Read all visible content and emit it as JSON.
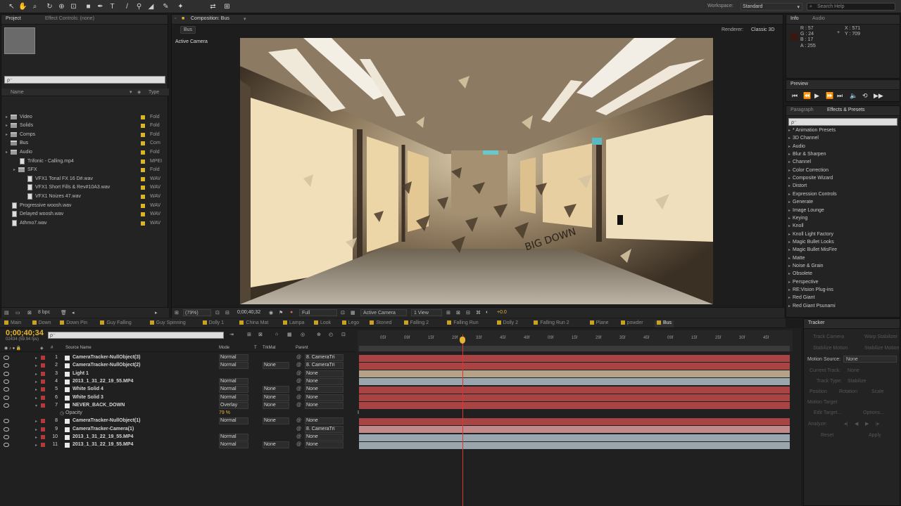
{
  "toolbar": {
    "workspace_label": "Workspace:",
    "workspace_value": "Standard",
    "search_placeholder": "Search Help"
  },
  "project": {
    "tabs": [
      "Project",
      "Effect Controls: (none)"
    ],
    "search_placeholder": "ρ⁻",
    "col_name": "Name",
    "col_type": "Type",
    "items": [
      {
        "name": "Video",
        "type": "Fold",
        "kind": "folder",
        "indent": 0
      },
      {
        "name": "Solids",
        "type": "Fold",
        "kind": "folder",
        "indent": 0
      },
      {
        "name": "Comps",
        "type": "Fold",
        "kind": "folder",
        "indent": 0
      },
      {
        "name": "Bus",
        "type": "Com",
        "kind": "comp",
        "indent": 0
      },
      {
        "name": "Audio",
        "type": "Fold",
        "kind": "folder",
        "indent": 0
      },
      {
        "name": "Trifonic - Calling.mp4",
        "type": "MPEI",
        "kind": "file",
        "indent": 1
      },
      {
        "name": "SFX",
        "type": "Fold",
        "kind": "folder",
        "indent": 1
      },
      {
        "name": "VFX1 Tonal FX 16 D#.wav",
        "type": "WAV",
        "kind": "file",
        "indent": 2
      },
      {
        "name": "VFX1 Short Fills & Rev#10A3.wav",
        "type": "WAV",
        "kind": "file",
        "indent": 2
      },
      {
        "name": "VFX1 Noizes 47.wav",
        "type": "WAV",
        "kind": "file",
        "indent": 2
      },
      {
        "name": "Progressive woosh.wav",
        "type": "WAV",
        "kind": "file",
        "indent": 0
      },
      {
        "name": "Delayed woosh.wav",
        "type": "WAV",
        "kind": "file",
        "indent": 0
      },
      {
        "name": "Athmo7.wav",
        "type": "WAV",
        "kind": "file",
        "indent": 0
      }
    ],
    "bpc": "8 bpc"
  },
  "composition": {
    "tab": "Composition: Bus",
    "breadcrumb": "Bus",
    "renderer_label": "Renderer:",
    "renderer_value": "Classic 3D",
    "view_label": "Active Camera",
    "footage_text": "BIG DOWN",
    "footer": {
      "zoom": "(79%)",
      "timecode": "0;00;40;32",
      "resolution": "Full",
      "camera": "Active Camera",
      "views": "1 View",
      "exposure": "+0.0"
    }
  },
  "info": {
    "tabs": [
      "Info",
      "Audio"
    ],
    "r": "R : 57",
    "g": "G : 24",
    "b": "B : 17",
    "a": "A : 255",
    "x": "X : 571",
    "y": "Y : 709",
    "sample_color": "#391811"
  },
  "preview": {
    "tab": "Preview"
  },
  "effects": {
    "tabs": [
      "Paragraph",
      "Effects & Presets"
    ],
    "search_placeholder": "ρ⁻",
    "items": [
      "* Animation Presets",
      "3D Channel",
      "Audio",
      "Blur & Sharpen",
      "Channel",
      "Color Correction",
      "Composite Wizard",
      "Distort",
      "Expression Controls",
      "Generate",
      "Image Lounge",
      "Keying",
      "Knoll",
      "Knoll Light Factory",
      "Magic Bullet Looks",
      "Magic Bullet MisFire",
      "Matte",
      "Noise & Grain",
      "Obsolete",
      "Perspective",
      "RE:Vision Plug-ins",
      "Red Giant",
      "Red Giant Psunami"
    ]
  },
  "timeline": {
    "comp_tabs": [
      "Main",
      "Down",
      "Down Pin",
      "Guy Falling",
      "Guy Spinning",
      "Dolly 1",
      "China Mat",
      "Lampa",
      "Look",
      "Lego",
      "Stoned",
      "Falling 2",
      "Falling Run",
      "Dolly 2",
      "Falling Run 2",
      "Plane",
      "powder",
      "Bus"
    ],
    "timecode": "0;00;40;34",
    "frame_info": "02434 (59.94 fps)",
    "headers": {
      "name": "Source Name",
      "mode": "Mode",
      "t": "T",
      "trkmat": "TrkMat",
      "parent": "Parent"
    },
    "ruler_ticks": [
      "05f",
      "09f",
      "15f",
      "29f",
      "33f",
      "45f",
      "49f",
      "09f",
      "15f",
      "29f",
      "35f",
      "45f",
      "09f",
      "15f",
      "25f",
      "30f",
      "45f"
    ],
    "layers": [
      {
        "num": "1",
        "name": "CameraTracker-NullObject(3)",
        "mode": "Normal",
        "trkmat": "",
        "parent": "8. CameraTri",
        "bar": "red"
      },
      {
        "num": "2",
        "name": "CameraTracker-NullObject(2)",
        "mode": "Normal",
        "trkmat": "None",
        "parent": "8. CameraTri",
        "bar": "red"
      },
      {
        "num": "3",
        "name": "Light 1",
        "mode": "",
        "trkmat": "",
        "parent": "None",
        "bar": "tan"
      },
      {
        "num": "4",
        "name": "2013_1_31_22_19_55.MP4",
        "mode": "Normal",
        "trkmat": "",
        "parent": "None",
        "bar": "blue"
      },
      {
        "num": "5",
        "name": "White Solid 4",
        "mode": "Normal",
        "trkmat": "None",
        "parent": "None",
        "bar": "red"
      },
      {
        "num": "6",
        "name": "White Solid 3",
        "mode": "Normal",
        "trkmat": "None",
        "parent": "None",
        "bar": "red"
      },
      {
        "num": "7",
        "name": "NEVER_BACK_DOWN",
        "mode": "Overlay",
        "trkmat": "None",
        "parent": "None",
        "bar": "red"
      },
      {
        "num": "",
        "name": "Opacity",
        "value": "79 %",
        "sub": true
      },
      {
        "num": "8",
        "name": "CameraTracker-NullObject(1)",
        "mode": "Normal",
        "trkmat": "None",
        "parent": "None",
        "bar": "red"
      },
      {
        "num": "9",
        "name": "CameraTracker-Camera(1)",
        "mode": "",
        "trkmat": "",
        "parent": "8. CameraTri",
        "bar": "pink"
      },
      {
        "num": "10",
        "name": "2013_1_31_22_19_55.MP4",
        "mode": "Normal",
        "trkmat": "",
        "parent": "None",
        "bar": "blue"
      },
      {
        "num": "11",
        "name": "2013_1_31_22_19_55.MP4",
        "mode": "Normal",
        "trkmat": "None",
        "parent": "None",
        "bar": "blue"
      }
    ],
    "playhead_fraction": 0.24
  },
  "tracker": {
    "tab": "Tracker",
    "items": [
      "Track Camera",
      "Warp Stabilizer",
      "Stabilize Motion",
      "Stabilize Motion"
    ],
    "motion_source_label": "Motion Source:",
    "motion_source_value": "None",
    "labels": [
      "Current Track:",
      "None",
      "Track Type:",
      "Stabilize",
      "Position",
      "Rotation",
      "Scale",
      "Motion Target",
      "Edit Target...",
      "Options...",
      "Analyze:",
      "Reset",
      "Apply"
    ]
  },
  "colors": {
    "label_red": "#b3393b",
    "bar_red": "#a84444",
    "bar_blue": "#9aa6ad",
    "bar_tan": "#b5a389",
    "bar_pink": "#c08a8a",
    "folder_yellow": "#d9b42a",
    "playhead": "#e03434",
    "timecode_yellow": "#e6b530"
  }
}
